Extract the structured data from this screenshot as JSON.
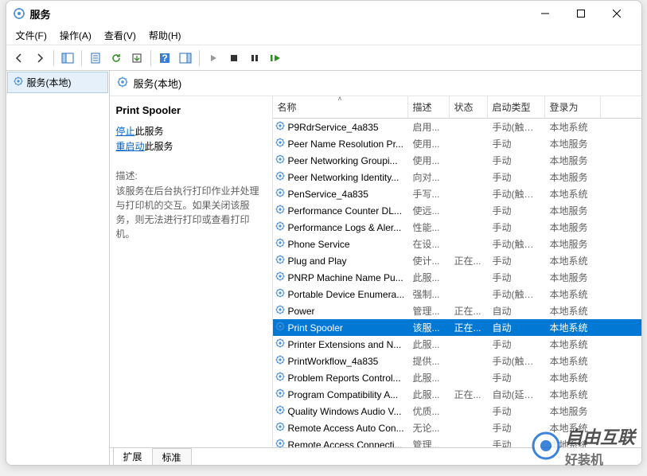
{
  "window": {
    "title": "服务"
  },
  "menu": {
    "file": "文件(F)",
    "action": "操作(A)",
    "view": "查看(V)",
    "help": "帮助(H)"
  },
  "nav": {
    "root": "服务(本地)"
  },
  "mainheader": {
    "title": "服务(本地)"
  },
  "detail": {
    "title": "Print Spooler",
    "stop_link": "停止",
    "stop_suffix": "此服务",
    "restart_link": "重启动",
    "restart_suffix": "此服务",
    "desc_label": "描述:",
    "desc_text": "该服务在后台执行打印作业并处理与打印机的交互。如果关闭该服务，则无法进行打印或查看打印机。"
  },
  "columns": {
    "name": "名称",
    "desc": "描述",
    "status": "状态",
    "start": "启动类型",
    "login": "登录为"
  },
  "services": [
    {
      "name": "P9RdrService_4a835",
      "desc": "启用...",
      "status": "",
      "start": "手动(触发...",
      "login": "本地系统"
    },
    {
      "name": "Peer Name Resolution Pr...",
      "desc": "使用...",
      "status": "",
      "start": "手动",
      "login": "本地服务"
    },
    {
      "name": "Peer Networking Groupi...",
      "desc": "使用...",
      "status": "",
      "start": "手动",
      "login": "本地服务"
    },
    {
      "name": "Peer Networking Identity...",
      "desc": "向对...",
      "status": "",
      "start": "手动",
      "login": "本地服务"
    },
    {
      "name": "PenService_4a835",
      "desc": "手写...",
      "status": "",
      "start": "手动(触发...",
      "login": "本地系统"
    },
    {
      "name": "Performance Counter DL...",
      "desc": "使远...",
      "status": "",
      "start": "手动",
      "login": "本地服务"
    },
    {
      "name": "Performance Logs & Aler...",
      "desc": "性能...",
      "status": "",
      "start": "手动",
      "login": "本地服务"
    },
    {
      "name": "Phone Service",
      "desc": "在设...",
      "status": "",
      "start": "手动(触发...",
      "login": "本地服务"
    },
    {
      "name": "Plug and Play",
      "desc": "使计...",
      "status": "正在...",
      "start": "手动",
      "login": "本地系统"
    },
    {
      "name": "PNRP Machine Name Pu...",
      "desc": "此服...",
      "status": "",
      "start": "手动",
      "login": "本地服务"
    },
    {
      "name": "Portable Device Enumera...",
      "desc": "强制...",
      "status": "",
      "start": "手动(触发...",
      "login": "本地系统"
    },
    {
      "name": "Power",
      "desc": "管理...",
      "status": "正在...",
      "start": "自动",
      "login": "本地系统"
    },
    {
      "name": "Print Spooler",
      "desc": "该服...",
      "status": "正在...",
      "start": "自动",
      "login": "本地系统",
      "selected": true
    },
    {
      "name": "Printer Extensions and N...",
      "desc": "此服...",
      "status": "",
      "start": "手动",
      "login": "本地系统"
    },
    {
      "name": "PrintWorkflow_4a835",
      "desc": "提供...",
      "status": "",
      "start": "手动(触发...",
      "login": "本地系统"
    },
    {
      "name": "Problem Reports Control...",
      "desc": "此服...",
      "status": "",
      "start": "手动",
      "login": "本地系统"
    },
    {
      "name": "Program Compatibility A...",
      "desc": "此服...",
      "status": "正在...",
      "start": "自动(延迟...",
      "login": "本地系统"
    },
    {
      "name": "Quality Windows Audio V...",
      "desc": "优质...",
      "status": "",
      "start": "手动",
      "login": "本地服务"
    },
    {
      "name": "Remote Access Auto Con...",
      "desc": "无论...",
      "status": "",
      "start": "手动",
      "login": "本地系统"
    },
    {
      "name": "Remote Access Connecti...",
      "desc": "管理...",
      "status": "",
      "start": "手动",
      "login": "本地系统"
    }
  ],
  "tabs": {
    "extended": "扩展",
    "standard": "标准"
  },
  "watermark": {
    "main": "自由互联",
    "sub": "好装机"
  }
}
